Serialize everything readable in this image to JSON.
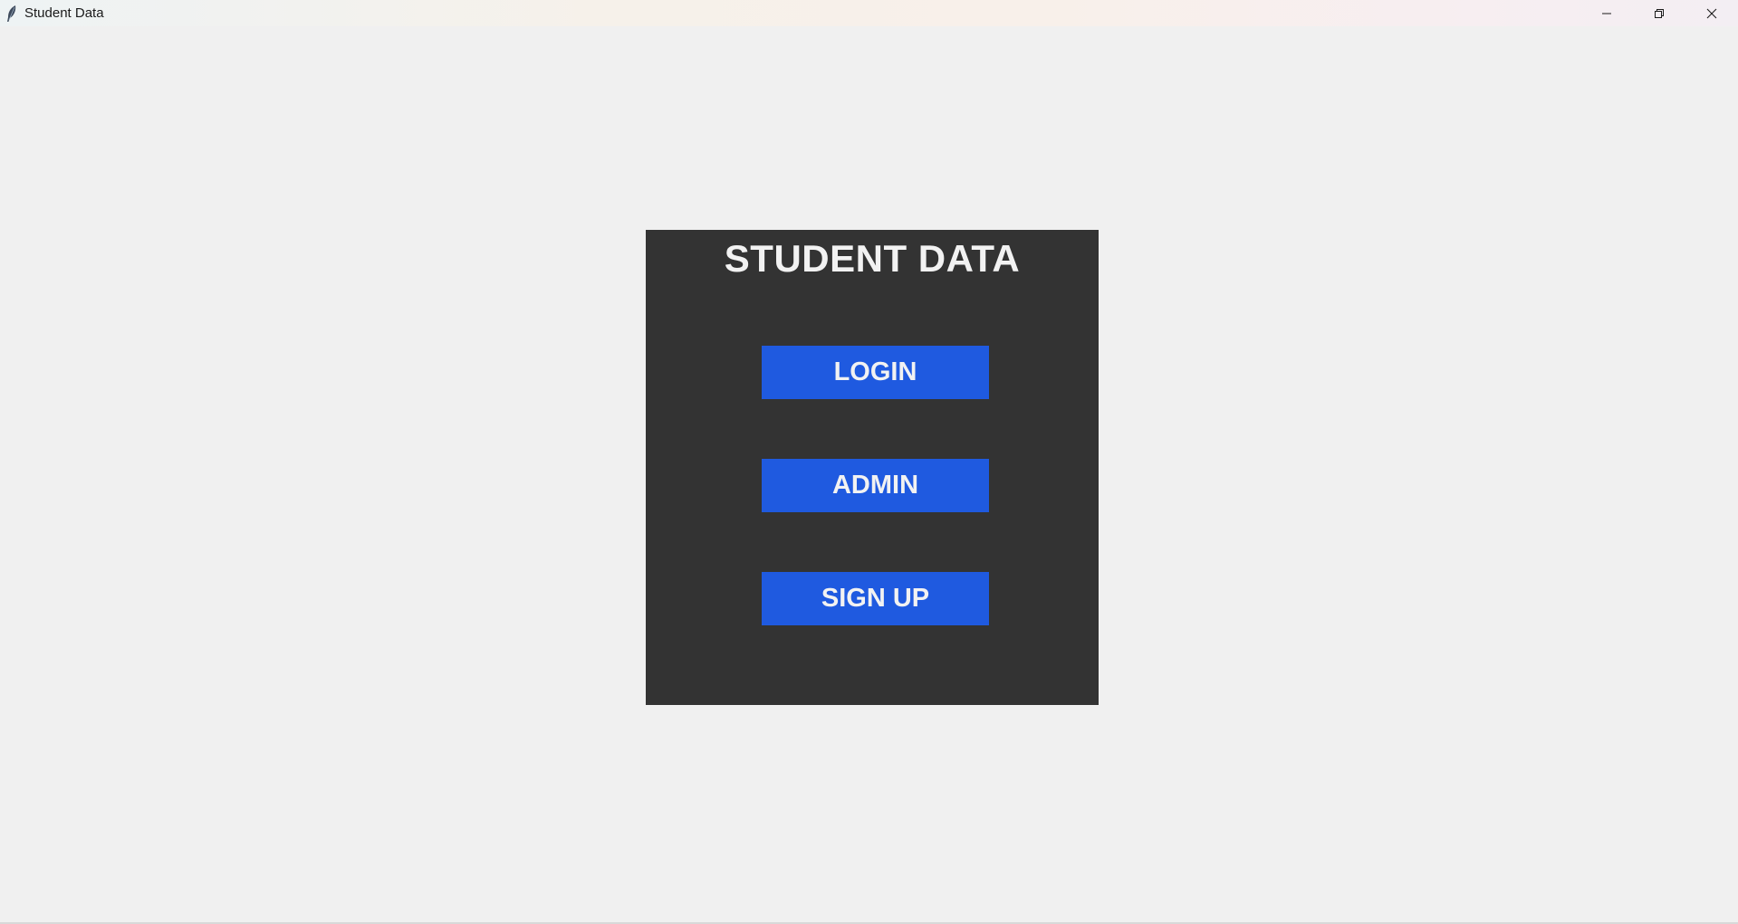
{
  "window": {
    "title": "Student Data",
    "icon": "feather-icon",
    "controls": [
      "minimize-icon",
      "restore-icon",
      "close-icon"
    ]
  },
  "panel": {
    "title": "STUDENT DATA",
    "buttons": {
      "login": "LOGIN",
      "admin": "ADMIN",
      "signup": "SIGN UP"
    }
  },
  "colors": {
    "background": "#f0f0f0",
    "panel": "#333333",
    "button": "#1f5ae0",
    "text": "#f2f2f2"
  }
}
